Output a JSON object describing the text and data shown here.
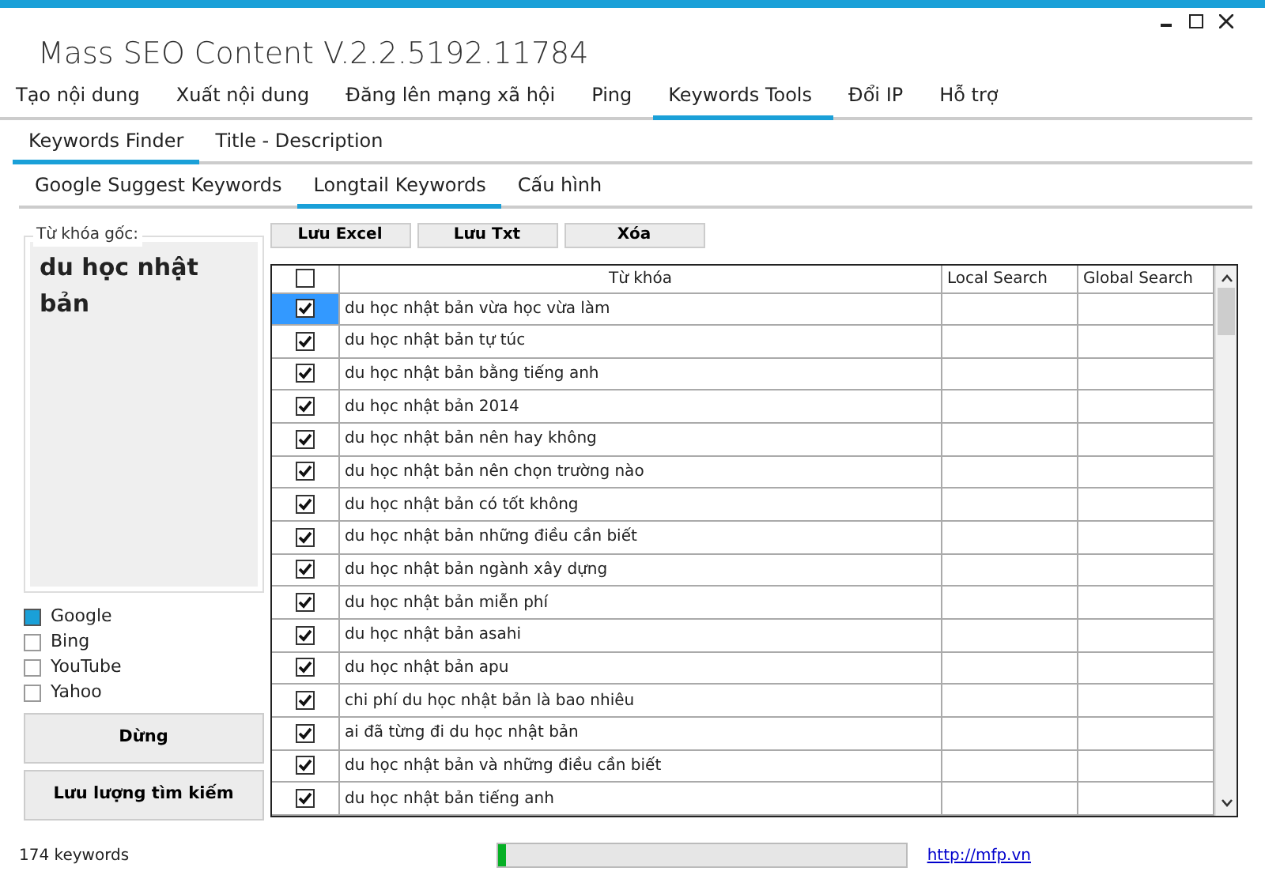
{
  "window": {
    "title": "Mass SEO Content V.2.2.5192.11784"
  },
  "main_tabs": [
    {
      "label": "Tạo nội dung",
      "selected": false
    },
    {
      "label": "Xuất nội dung",
      "selected": false
    },
    {
      "label": "Đăng lên mạng xã hội",
      "selected": false
    },
    {
      "label": "Ping",
      "selected": false
    },
    {
      "label": "Keywords Tools",
      "selected": true
    },
    {
      "label": "Đổi IP",
      "selected": false
    },
    {
      "label": "Hỗ trợ",
      "selected": false
    }
  ],
  "sub_tabs": [
    {
      "label": "Keywords Finder",
      "selected": true
    },
    {
      "label": "Title - Description",
      "selected": false
    }
  ],
  "tool_tabs": [
    {
      "label": "Google Suggest Keywords",
      "selected": false
    },
    {
      "label": "Longtail Keywords",
      "selected": true
    },
    {
      "label": "Cấu hình",
      "selected": false
    }
  ],
  "seed": {
    "label": "Từ khóa gốc:",
    "value": "du học nhật bản"
  },
  "engines": [
    {
      "label": "Google",
      "checked": true
    },
    {
      "label": "Bing",
      "checked": false
    },
    {
      "label": "YouTube",
      "checked": false
    },
    {
      "label": "Yahoo",
      "checked": false
    }
  ],
  "side_buttons": [
    "Dừng",
    "Lưu lượng tìm kiếm"
  ],
  "toolbar_buttons": [
    "Lưu Excel",
    "Lưu Txt",
    "Xóa"
  ],
  "table": {
    "select_all": false,
    "columns": [
      "Từ khóa",
      "Local Search",
      "Global Search"
    ],
    "rows": [
      {
        "keyword": "du học nhật bản vừa học vừa làm",
        "checked": true,
        "selected": true
      },
      {
        "keyword": "du học nhật bản tự túc",
        "checked": true,
        "selected": false
      },
      {
        "keyword": "du học nhật bản bằng tiếng anh",
        "checked": true,
        "selected": false
      },
      {
        "keyword": "du học nhật bản 2014",
        "checked": true,
        "selected": false
      },
      {
        "keyword": "du học nhật bản nên hay không",
        "checked": true,
        "selected": false
      },
      {
        "keyword": "du học nhật bản nên chọn trường nào",
        "checked": true,
        "selected": false
      },
      {
        "keyword": "du học nhật bản có tốt không",
        "checked": true,
        "selected": false
      },
      {
        "keyword": "du học nhật bản những điều cần biết",
        "checked": true,
        "selected": false
      },
      {
        "keyword": "du học nhật bản ngành xây dựng",
        "checked": true,
        "selected": false
      },
      {
        "keyword": "du học nhật bản miễn phí",
        "checked": true,
        "selected": false
      },
      {
        "keyword": "du học nhật bản asahi",
        "checked": true,
        "selected": false
      },
      {
        "keyword": "du học nhật bản apu",
        "checked": true,
        "selected": false
      },
      {
        "keyword": "chi phí du học nhật bản là bao nhiêu",
        "checked": true,
        "selected": false
      },
      {
        "keyword": "ai đã từng đi du học nhật bản",
        "checked": true,
        "selected": false
      },
      {
        "keyword": "du học nhật bản và những điều cần biết",
        "checked": true,
        "selected": false
      },
      {
        "keyword": "du học nhật bản tiếng anh",
        "checked": true,
        "selected": false
      }
    ]
  },
  "status_bar": {
    "count": "174 keywords",
    "progress": {
      "level": 0.02
    },
    "link": "http://mfp.vn"
  }
}
